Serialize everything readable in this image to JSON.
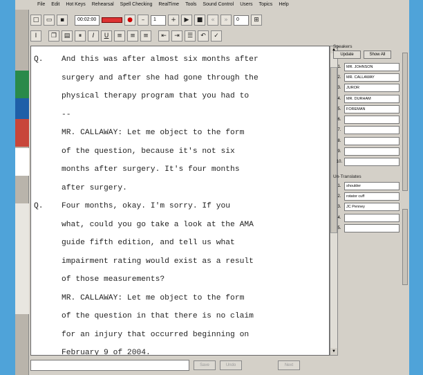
{
  "menu": [
    "File",
    "Edit",
    "Hot Keys",
    "Rehearsal",
    "Spell Checking",
    "RealTime",
    "Tools",
    "Sound Control",
    "Users",
    "Topics",
    "Help"
  ],
  "toolbar": {
    "time": "00:02:00",
    "page": "1",
    "line": "0"
  },
  "transcript": [
    {
      "marker": "Q.",
      "text": "And this was after almost six months after"
    },
    {
      "marker": "",
      "text": "surgery and after she had gone through the"
    },
    {
      "marker": "",
      "text": "physical therapy program that you had to"
    },
    {
      "marker": "",
      "text": "--"
    },
    {
      "marker": "",
      "text": "MR. CALLAWAY:  Let me object to the form"
    },
    {
      "marker": "",
      "text": "of the question, because it's not six"
    },
    {
      "marker": "",
      "text": "months after surgery.  It's four months"
    },
    {
      "marker": "",
      "text": "after surgery."
    },
    {
      "marker": "Q.",
      "text": "Four months, okay.  I'm sorry.  If you"
    },
    {
      "marker": "",
      "text": "what, could you go take a look at the AMA"
    },
    {
      "marker": "",
      "text": "guide fifth edition, and tell us what"
    },
    {
      "marker": "",
      "text": "impairment rating would exist as a result"
    },
    {
      "marker": "",
      "text": "of those measurements?"
    },
    {
      "marker": "",
      "text": "MR. CALLAWAY:  Let me object to the form"
    },
    {
      "marker": "",
      "text": "of the question in that there is no claim"
    },
    {
      "marker": "",
      "text": "for an injury that occurred beginning on"
    },
    {
      "marker": "",
      "text": "February 9 of 2004."
    }
  ],
  "speakers": {
    "title": "Speakers",
    "update_label": "Update",
    "show_all_label": "Show All",
    "rows": [
      {
        "num": "1.",
        "name": "MR. JOHNSON"
      },
      {
        "num": "2.",
        "name": "MR. CALLAWAY"
      },
      {
        "num": "3.",
        "name": "JUROR"
      },
      {
        "num": "4.",
        "name": "MR. DURHAM"
      },
      {
        "num": "5.",
        "name": "FOREMAN"
      },
      {
        "num": "6.",
        "name": ""
      },
      {
        "num": "7.",
        "name": ""
      },
      {
        "num": "8.",
        "name": ""
      },
      {
        "num": "9.",
        "name": ""
      },
      {
        "num": "10.",
        "name": ""
      }
    ]
  },
  "untranslates": {
    "title": "Un-Translates",
    "rows": [
      {
        "num": "1.",
        "value": "shoulder"
      },
      {
        "num": "2.",
        "value": "rotator cuff"
      },
      {
        "num": "3.",
        "value": "JC Penney"
      },
      {
        "num": "4.",
        "value": ""
      },
      {
        "num": "5.",
        "value": ""
      }
    ]
  },
  "bottom": {
    "btn1": "Save",
    "btn2": "Undo",
    "btn3": "Next"
  }
}
